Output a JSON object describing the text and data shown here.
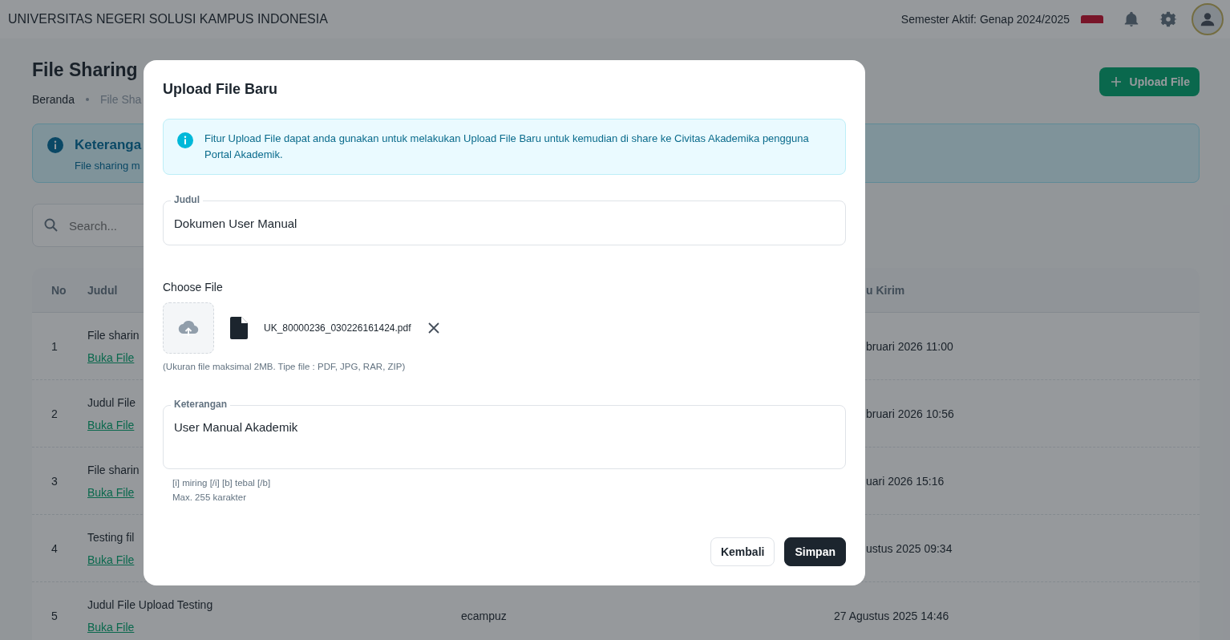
{
  "header": {
    "university": "UNIVERSITAS NEGERI SOLUSI KAMPUS INDONESIA",
    "semester": "Semester Aktif: Genap 2024/2025"
  },
  "page": {
    "title": "File Sharing",
    "breadcrumb": [
      "Beranda",
      "File Sha"
    ],
    "upload_button": "Upload File"
  },
  "info": {
    "title": "Keteranga",
    "text": "File sharing m"
  },
  "search": {
    "placeholder": "Search..."
  },
  "table": {
    "columns": [
      "No",
      "Judul",
      "u Kirim"
    ],
    "rows": [
      {
        "no": "1",
        "title": "File sharin",
        "link": "Buka File",
        "date": "bruari 2026 11:00"
      },
      {
        "no": "2",
        "title": "Judul File",
        "link": "Buka File",
        "date": "bruari 2026 10:56"
      },
      {
        "no": "3",
        "title": "File sharin",
        "link": "Buka File",
        "date": "uari 2026 15:16"
      },
      {
        "no": "4",
        "title": "Testing fil",
        "link": "Buka File",
        "date": "ustus 2025 09:34"
      },
      {
        "no": "5",
        "title": "Judul File Upload Testing",
        "link": "Buka File",
        "sender": "ecampuz",
        "date": "27 Agustus 2025 14:46"
      }
    ]
  },
  "modal": {
    "title": "Upload File Baru",
    "alert": "Fitur Upload File dapat anda gunakan untuk melakukan Upload File Baru untuk kemudian di share ke Civitas Akademika pengguna Portal Akademik.",
    "title_field": {
      "label": "Judul",
      "value": "Dokumen User Manual"
    },
    "file": {
      "label": "Choose File",
      "name": "UK_80000236_030226161424.pdf",
      "hint": "(Ukuran file maksimal 2MB. Tipe file : PDF, JPG, RAR, ZIP)"
    },
    "note_field": {
      "label": "Keterangan",
      "value": "User Manual Akademik",
      "help": [
        "[i] miring [/i] [b] tebal [/b]",
        "Max. 255 karakter"
      ]
    },
    "buttons": {
      "back": "Kembali",
      "save": "Simpan"
    }
  }
}
